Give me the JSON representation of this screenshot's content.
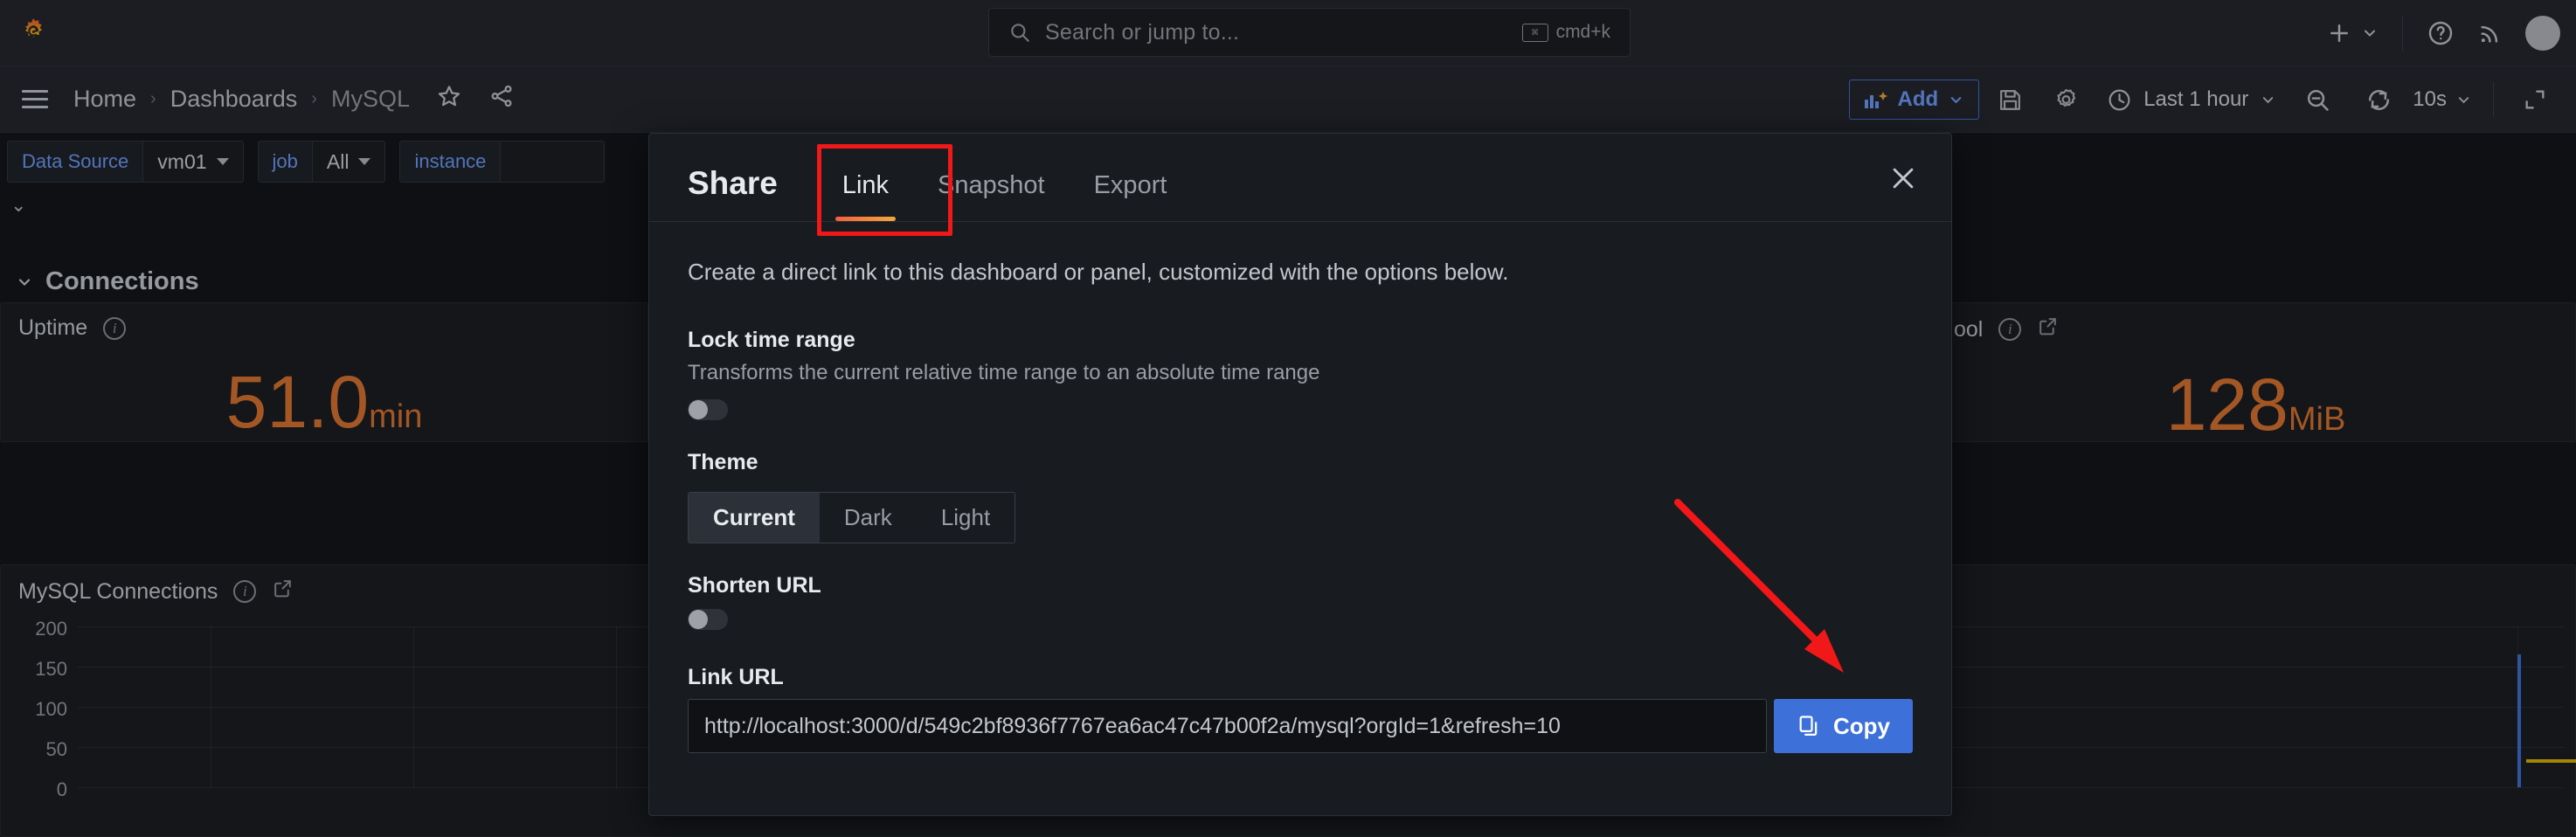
{
  "topnav": {
    "logo_icon": "grafana-logo-icon",
    "search": {
      "placeholder": "Search or jump to...",
      "shortcut": "cmd+k",
      "icon": "search-icon"
    },
    "add_icon": "plus-icon",
    "help_icon": "question-circle-icon",
    "news_icon": "rss-feed-icon",
    "avatar": "user-avatar"
  },
  "breadcrumb": {
    "menu_icon": "hamburger-menu-icon",
    "items": [
      {
        "label": "Home"
      },
      {
        "label": "Dashboards"
      },
      {
        "label": "MySQL"
      }
    ],
    "separator": "›",
    "star_icon": "star-outline-icon",
    "share_icon": "share-nodes-icon"
  },
  "toolbar": {
    "add_label": "Add",
    "add_icon": "panel-add-icon",
    "save_icon": "save-disk-icon",
    "settings_icon": "gear-icon",
    "time_range": "Last 1 hour",
    "clock_icon": "clock-icon",
    "zoom_out_icon": "zoom-out-icon",
    "refresh_icon": "refresh-icon",
    "refresh_interval": "10s"
  },
  "variables": [
    {
      "label": "Data Source",
      "value": "vm01",
      "has_dropdown": true
    },
    {
      "label": "job",
      "value": "All",
      "has_dropdown": true
    },
    {
      "label": "instance",
      "value": "",
      "has_dropdown": false
    }
  ],
  "dashboard": {
    "uptime_panel": {
      "title": "Uptime",
      "info_icon": "info-circle-icon",
      "value": "51.0",
      "unit": "min"
    },
    "right_panel": {
      "title": "ool",
      "info_icon": "info-circle-icon",
      "external_icon": "external-link-icon",
      "value": "128",
      "unit": "MiB"
    },
    "row_header": {
      "label": "Connections",
      "caret_icon": "chevron-down-icon"
    },
    "connections_panel": {
      "title": "MySQL Connections",
      "info_icon": "info-circle-icon",
      "external_icon": "external-link-icon"
    }
  },
  "chart_data": {
    "type": "line",
    "title": "MySQL Connections",
    "ylabel": "",
    "xlabel": "",
    "ylim": [
      0,
      200
    ],
    "ticks": [
      "200",
      "150",
      "100",
      "50",
      "0"
    ],
    "grid": true,
    "series": []
  },
  "modal": {
    "title": "Share",
    "tabs": [
      {
        "label": "Link",
        "active": true
      },
      {
        "label": "Snapshot",
        "active": false
      },
      {
        "label": "Export",
        "active": false
      }
    ],
    "close_icon": "close-icon",
    "description": "Create a direct link to this dashboard or panel, customized with the options below.",
    "lock_time_range": {
      "label": "Lock time range",
      "sublabel": "Transforms the current relative time range to an absolute time range",
      "enabled": false
    },
    "theme": {
      "label": "Theme",
      "options": [
        "Current",
        "Dark",
        "Light"
      ],
      "selected": "Current"
    },
    "shorten_url": {
      "label": "Shorten URL",
      "enabled": false
    },
    "link_url": {
      "label": "Link URL",
      "value": "http://localhost:3000/d/549c2bf8936f7767ea6ac47c47b00f2a/mysql?orgId=1&refresh=10"
    },
    "copy_button": {
      "label": "Copy",
      "icon": "copy-icon"
    }
  },
  "colors": {
    "accent_blue": "#3d71d9",
    "accent_orange": "#e0752d",
    "annotation_red": "#f01818",
    "tab_underline": "#f55f3e"
  }
}
